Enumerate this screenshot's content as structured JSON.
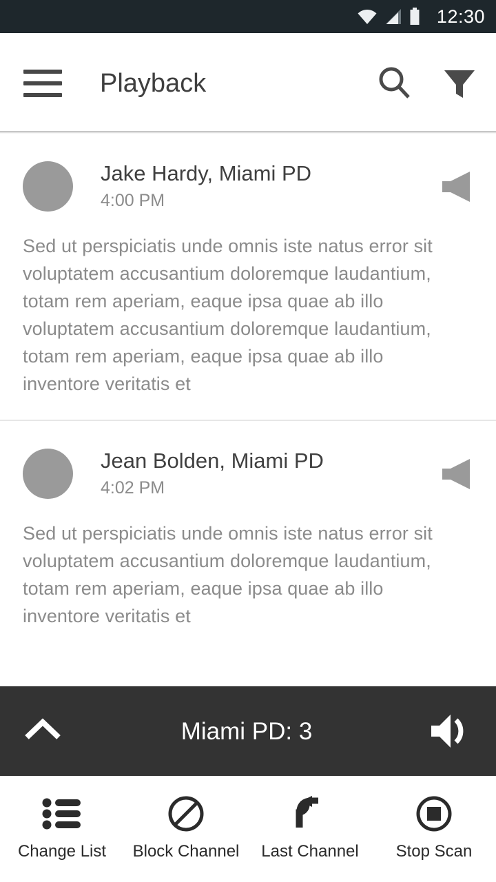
{
  "status_bar": {
    "time": "12:30",
    "icons": [
      "wifi-icon",
      "cell-signal-icon",
      "battery-icon"
    ],
    "background_color": "#1e272c"
  },
  "app_bar": {
    "menu_icon": "hamburger-menu-icon",
    "title": "Playback",
    "actions": [
      {
        "icon": "search-icon",
        "name": "search-button"
      },
      {
        "icon": "filter-icon",
        "name": "filter-button"
      }
    ]
  },
  "messages": [
    {
      "avatar": "avatar-placeholder",
      "author": "Jake Hardy, Miami PD",
      "time": "4:00 PM",
      "speaker_icon": "speaker-icon",
      "body": "Sed ut perspiciatis unde omnis iste natus error sit voluptatem accusantium doloremque laudantium, totam rem aperiam, eaque ipsa quae ab illo voluptatem accusantium doloremque laudantium, totam rem aperiam, eaque ipsa quae ab illo inventore veritatis et"
    },
    {
      "avatar": "avatar-placeholder",
      "author": "Jean Bolden, Miami PD",
      "time": "4:02 PM",
      "speaker_icon": "speaker-icon",
      "body": "Sed ut perspiciatis unde omnis iste natus error sit voluptatem accusantium doloremque laudantium, totam rem aperiam, eaque ipsa quae ab illo inventore veritatis et"
    }
  ],
  "now_playing": {
    "expand_icon": "chevron-up-icon",
    "label": "Miami PD: 3",
    "volume_icon": "volume-icon",
    "background_color": "#333333"
  },
  "bottom_nav": {
    "items": [
      {
        "label": "Change List",
        "icon": "list-icon"
      },
      {
        "label": "Block Channel",
        "icon": "block-icon"
      },
      {
        "label": "Last Channel",
        "icon": "undo-arrow-icon"
      },
      {
        "label": "Stop Scan",
        "icon": "stop-icon"
      }
    ]
  },
  "colors": {
    "status_bar": "#1e272c",
    "now_playing": "#333333",
    "primary_text": "#3f3f3f",
    "secondary_text": "#8b8b8b",
    "avatar": "#9a9a9a"
  }
}
